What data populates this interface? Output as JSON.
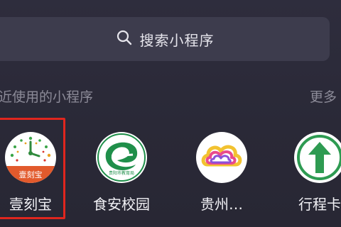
{
  "search": {
    "placeholder": "搜索小程序",
    "icon": "search-icon"
  },
  "recent_section": {
    "title": "近使用的小程序",
    "more_label": "更多"
  },
  "apps": [
    {
      "name": "壹刻宝",
      "badge_text": "壹刻宝",
      "icon": "clock-icon",
      "highlighted": true
    },
    {
      "name": "食安校园",
      "icon": "e-leaf-icon",
      "icon_caption": "贵阳市教育局",
      "highlighted": false
    },
    {
      "name": "贵州…",
      "icon": "rainbow-cloud-icon",
      "highlighted": false
    },
    {
      "name": "行程卡",
      "icon": "up-arrow-icon",
      "highlighted": false
    }
  ],
  "colors": {
    "background": "#2b2a39",
    "search_bar": "#3d3c4d",
    "highlight": "#e0261e",
    "muted_text": "#8c8b98"
  }
}
